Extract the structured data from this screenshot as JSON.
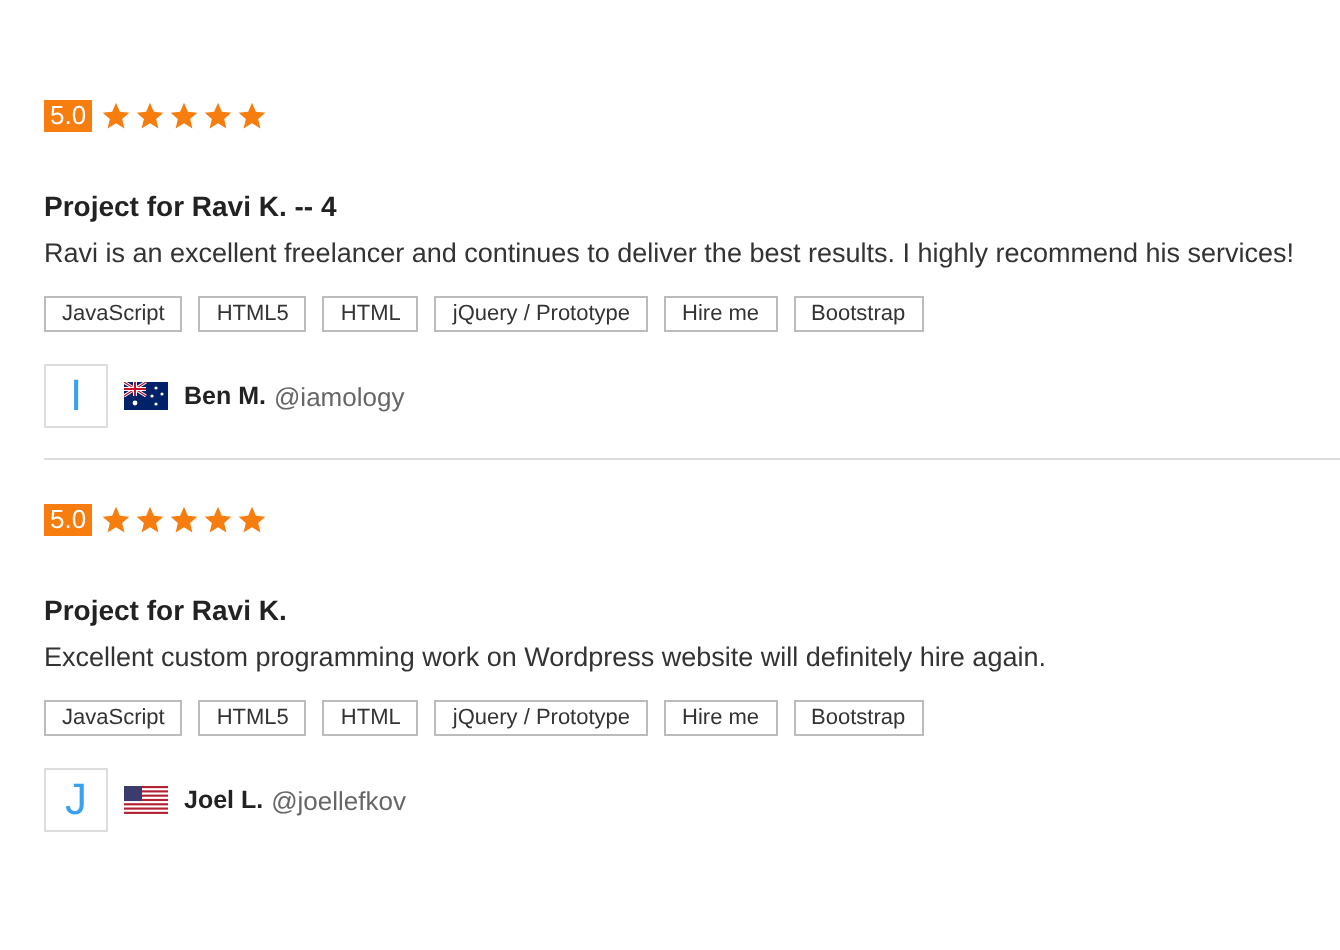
{
  "reviews": [
    {
      "rating": "5.0",
      "stars": 5,
      "title": "Project for Ravi K. -- 4",
      "text": "Ravi is an excellent freelancer and continues to deliver the best results. I highly recommend his services!",
      "tags": [
        "JavaScript",
        "HTML5",
        "HTML",
        "jQuery / Prototype",
        "Hire me",
        "Bootstrap"
      ],
      "avatar": "I",
      "kind": "au",
      "name": "Ben M.",
      "handle": "@iamology"
    },
    {
      "rating": "5.0",
      "stars": 5,
      "title": "Project for Ravi K.",
      "text": "Excellent custom programming work on Wordpress website will definitely hire again.",
      "tags": [
        "JavaScript",
        "HTML5",
        "HTML",
        "jQuery / Prototype",
        "Hire me",
        "Bootstrap"
      ],
      "avatar": "J",
      "kind": "us",
      "name": "Joel L.",
      "handle": "@joellefkov"
    }
  ]
}
